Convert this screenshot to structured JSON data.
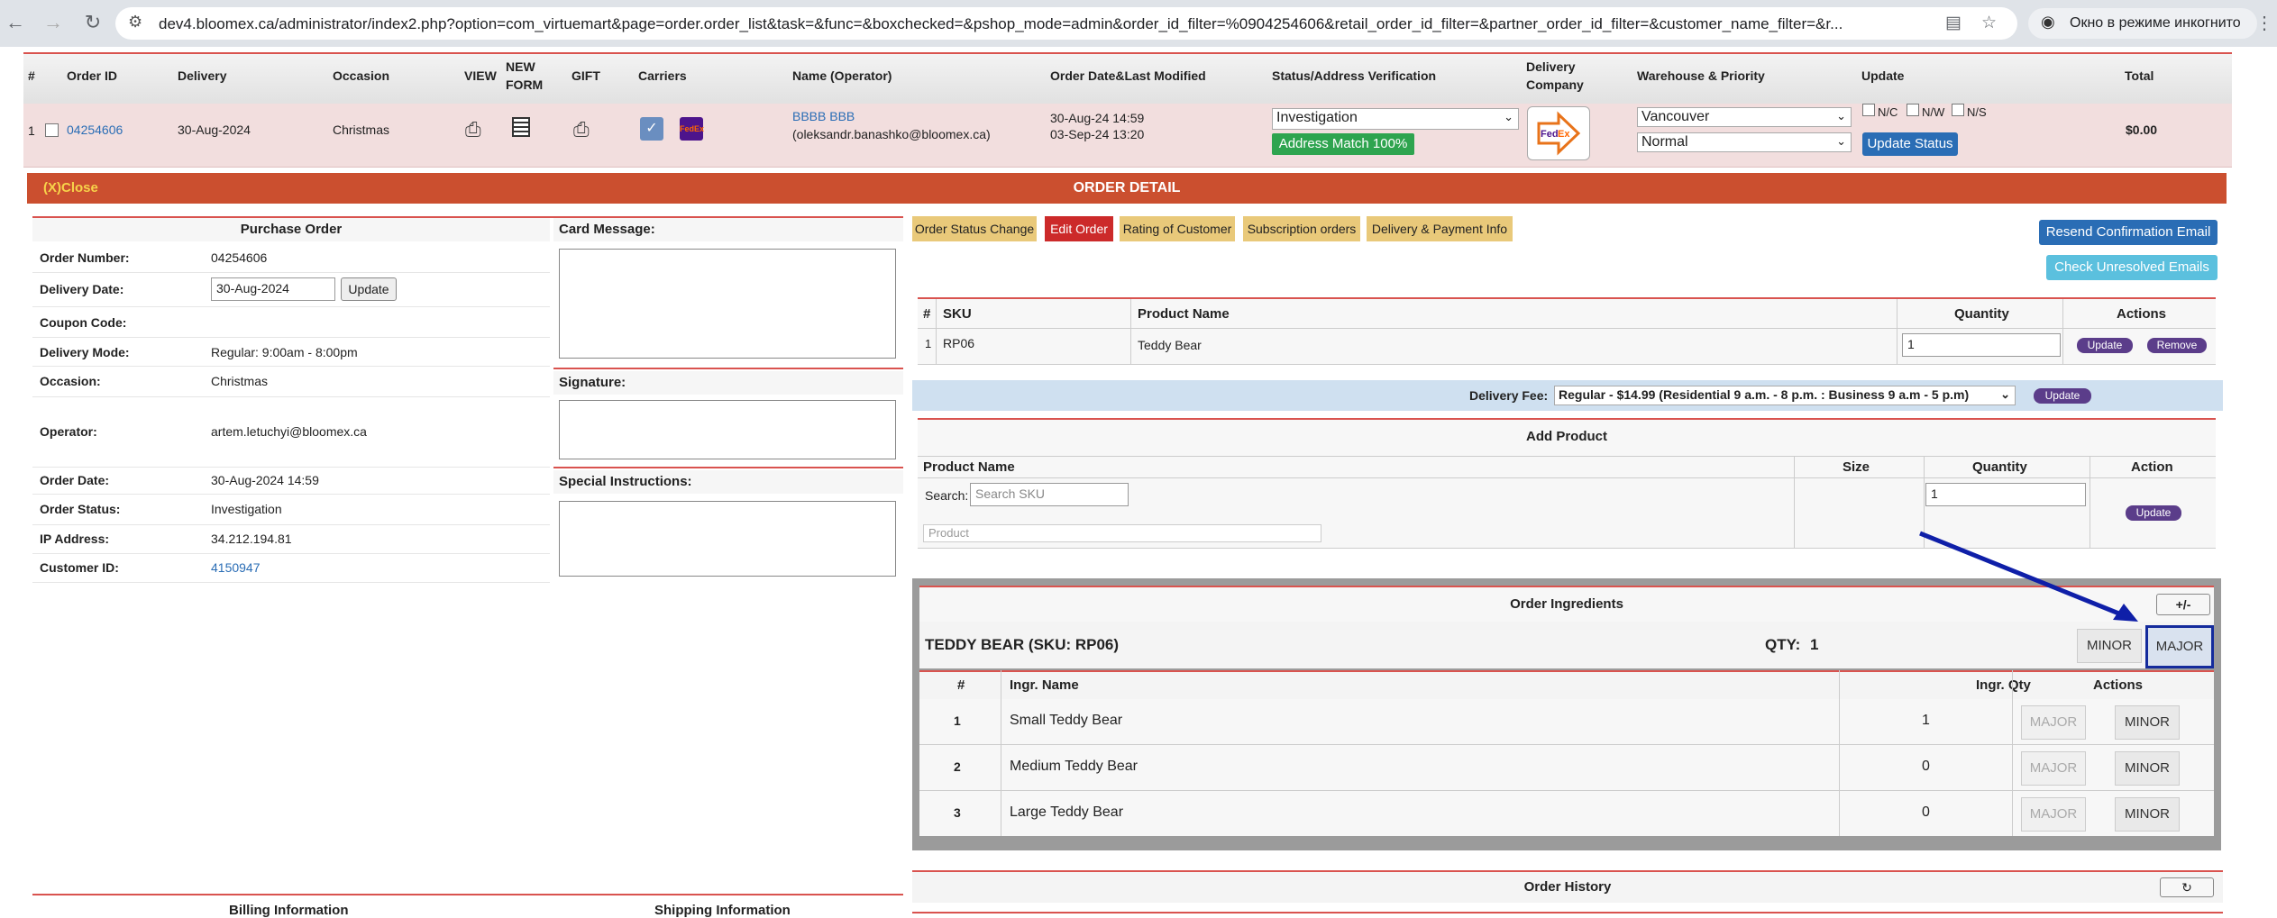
{
  "browser": {
    "url": "dev4.bloomex.ca/administrator/index2.php?option=com_virtuemart&page=order.order_list&task=&func=&boxchecked=&pshop_mode=admin&order_id_filter=%0904254606&retail_order_id_filter=&partner_order_id_filter=&customer_name_filter=&r...",
    "incognito_label": "Окно в режиме инкогнито"
  },
  "list_header": {
    "num": "#",
    "order_id": "Order ID",
    "delivery": "Delivery",
    "occasion": "Occasion",
    "view": "VIEW",
    "new": "NEW",
    "form": "FORM",
    "gift": "GIFT",
    "carriers": "Carriers",
    "name": "Name (Operator)",
    "order_date": "Order Date&Last Modified",
    "status": "Status/Address Verification",
    "delivery_company_1": "Delivery",
    "delivery_company_2": "Company",
    "warehouse": "Warehouse & Priority",
    "update": "Update",
    "total": "Total"
  },
  "order_row": {
    "num": "1",
    "order_id": "04254606",
    "delivery": "30-Aug-2024",
    "occasion": "Christmas",
    "name": "BBBB BBB",
    "operator": "(oleksandr.banashko@bloomex.ca)",
    "order_date": "30-Aug-24 14:59",
    "modified": "03-Sep-24 13:20",
    "status": "Investigation",
    "address_match": "Address Match 100%",
    "warehouse": "Vancouver",
    "priority": "Normal",
    "nc": "N/C",
    "nw": "N/W",
    "ns": "N/S",
    "update_status": "Update Status",
    "total": "$0.00"
  },
  "detail": {
    "close": "(X)Close",
    "title": "ORDER DETAIL"
  },
  "purchase_order": {
    "title": "Purchase Order",
    "order_number_label": "Order Number:",
    "order_number": "04254606",
    "delivery_date_label": "Delivery Date:",
    "delivery_date": "30-Aug-2024",
    "update_btn": "Update",
    "coupon_label": "Coupon Code:",
    "delivery_mode_label": "Delivery Mode:",
    "delivery_mode": "Regular: 9:00am - 8:00pm",
    "occasion_label": "Occasion:",
    "occasion": "Christmas",
    "operator_label": "Operator:",
    "operator": "artem.letuchyi@bloomex.ca",
    "order_date_label": "Order Date:",
    "order_date": "30-Aug-2024 14:59",
    "order_status_label": "Order Status:",
    "order_status": "Investigation",
    "ip_label": "IP Address:",
    "ip": "34.212.194.81",
    "customer_label": "Customer ID:",
    "customer": "4150947"
  },
  "messages": {
    "card": "Card Message:",
    "signature": "Signature:",
    "special": "Special Instructions:"
  },
  "bottom": {
    "billing": "Billing Information",
    "shipping": "Shipping Information",
    "history": "Order History"
  },
  "tabs": [
    "Order Status Change",
    "Edit Order",
    "Rating of Customer",
    "Subscription orders",
    "Delivery & Payment Info"
  ],
  "actions": {
    "resend": "Resend Confirmation Email",
    "unresolved": "Check Unresolved Emails"
  },
  "products": {
    "headers": {
      "num": "#",
      "sku": "SKU",
      "name": "Product Name",
      "qty": "Quantity",
      "actions": "Actions"
    },
    "rows": [
      {
        "num": "1",
        "sku": "RP06",
        "name": "Teddy Bear",
        "qty": "1",
        "update": "Update",
        "remove": "Remove"
      }
    ],
    "delivery_fee_label": "Delivery Fee:",
    "delivery_fee": "Regular - $14.99 (Residential 9 a.m. - 8 p.m. : Business 9 a.m - 5 p.m)",
    "fee_update": "Update"
  },
  "add_product": {
    "title": "Add Product",
    "headers": {
      "name": "Product Name",
      "size": "Size",
      "qty": "Quantity",
      "action": "Action"
    },
    "search_label": "Search:",
    "search_placeholder": "Search SKU",
    "product_placeholder": "Product",
    "qty": "1",
    "update": "Update"
  },
  "ingredients": {
    "title": "Order Ingredients",
    "toggle": "+/-",
    "product": "TEDDY BEAR (SKU: RP06)",
    "qty_label": "QTY:",
    "qty": "1",
    "minor": "MINOR",
    "major": "MAJOR",
    "headers": {
      "num": "#",
      "name": "Ingr. Name",
      "qty": "Ingr. Qty",
      "actions": "Actions"
    },
    "rows": [
      {
        "num": "1",
        "name": "Small Teddy Bear",
        "qty": "1",
        "major": "MAJOR",
        "minor": "MINOR"
      },
      {
        "num": "2",
        "name": "Medium Teddy Bear",
        "qty": "0",
        "major": "MAJOR",
        "minor": "MINOR"
      },
      {
        "num": "3",
        "name": "Large Teddy Bear",
        "qty": "0",
        "major": "MAJOR",
        "minor": "MINOR"
      }
    ]
  },
  "colors": {
    "accent_red": "#cb4f2f",
    "tab_yellow": "#e9c97a",
    "link_blue": "#2a6db5",
    "annotation_arrow": "#0f1fa8"
  }
}
